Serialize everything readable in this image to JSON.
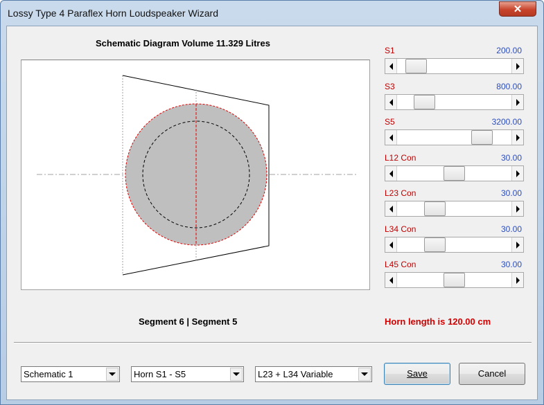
{
  "window": {
    "title": "Lossy Type 4 Paraflex Horn Loudspeaker Wizard",
    "close_icon": "close-x-icon"
  },
  "diagram": {
    "heading": "Schematic Diagram   Volume 11.329 Litres"
  },
  "sliders": [
    {
      "label": "S1",
      "value": "200.00",
      "position": 0.09
    },
    {
      "label": "S3",
      "value": "800.00",
      "position": 0.18
    },
    {
      "label": "S5",
      "value": "3200.00",
      "position": 0.8
    },
    {
      "label": "L12  Con",
      "value": "30.00",
      "position": 0.5
    },
    {
      "label": "L23  Con",
      "value": "30.00",
      "position": 0.29
    },
    {
      "label": "L34  Con",
      "value": "30.00",
      "position": 0.29
    },
    {
      "label": "L45  Con",
      "value": "30.00",
      "position": 0.5
    }
  ],
  "segments_text": "Segment 6  |  Segment 5",
  "horn_length_text": "Horn length is 120.00 cm",
  "dropdowns": {
    "schematic": "Schematic 1",
    "horn": "Horn S1 - S5",
    "variable": "L23 + L34 Variable"
  },
  "buttons": {
    "save": "Save",
    "cancel": "Cancel"
  },
  "colors": {
    "label_red": "#c00000",
    "value_blue": "#2a4dbf",
    "horn_length_red": "#d00000",
    "circle_fill": "#bfbfbf"
  }
}
